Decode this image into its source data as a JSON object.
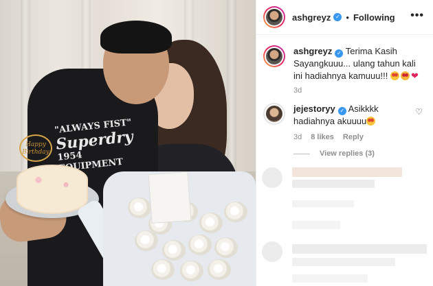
{
  "post": {
    "author": "ashgreyz",
    "follow_label": "Following",
    "more_icon": "more-horizontal-icon",
    "caption": {
      "username": "ashgreyz",
      "text": "Terima Kasih Sayangkuuu... ulang tahun kali ini hadiahnya kamuuu!!!",
      "time": "3d"
    }
  },
  "photo": {
    "tee_line1": "\"ALWAYS FIST\"",
    "tee_line2": "Superdry",
    "tee_line3": "1954",
    "tee_line4": "EQUIPMENT",
    "topper_text": "Happy Birthday"
  },
  "comments": [
    {
      "username": "jejestoryy",
      "text": "Asikkkk hadiahnya akuuuu",
      "time": "3d",
      "likes": "8 likes",
      "reply_label": "Reply",
      "view_replies": "View replies (3)"
    }
  ],
  "colors": {
    "verified": "#3897f0",
    "meta_text": "#8e8e8e",
    "story_ring": "#e6285e"
  }
}
